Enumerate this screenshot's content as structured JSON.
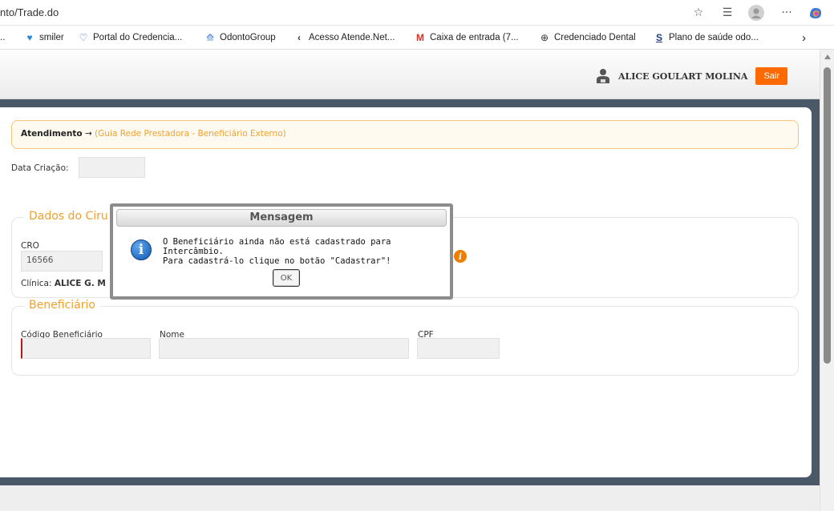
{
  "browser": {
    "address": "nto/Trade.do",
    "bookmarks": [
      {
        "label": "smiler",
        "icon": "tooth-icon"
      },
      {
        "label": "Portal do Credencia...",
        "icon": "heart-icon"
      },
      {
        "label": "OdontoGroup",
        "icon": "odontogroup-icon"
      },
      {
        "label": "Acesso Atende.Net...",
        "icon": "chevron-left-icon"
      },
      {
        "label": "Caixa de entrada (7...",
        "icon": "gmail-icon"
      },
      {
        "label": "Credenciado Dental",
        "icon": "globe-icon"
      },
      {
        "label": "Plano de saúde odo...",
        "icon": "s-logo-icon"
      }
    ]
  },
  "header": {
    "user_name": "ALICE GOULART MOLINA",
    "logout_label": "Sair"
  },
  "breadcrumb": {
    "main": "Atendimento",
    "arrow": "→",
    "sub": "(Guia Rede Prestadora - Beneficiário Externo)"
  },
  "form": {
    "creation_date_label": "Data Criação:",
    "creation_date_value": "",
    "surgeon_section": {
      "legend": "Dados do Ciru",
      "cro_label": "CRO",
      "cro_value": "16566",
      "clinic_label": "Clínica:",
      "clinic_value": "ALICE G. M"
    },
    "beneficiary_section": {
      "legend": "Beneficiário",
      "code_label": "Código Beneficiário",
      "name_label": "Nome",
      "cpf_label": "CPF"
    }
  },
  "dialog": {
    "title": "Mensagem",
    "line1": "O Beneficiário ainda não está cadastrado para Intercâmbio.",
    "line2": "Para cadastrá-lo clique no botão \"Cadastrar\"!",
    "ok_label": "OK"
  },
  "colors": {
    "accent_orange": "#f0a030",
    "logout_orange": "#ff6a00",
    "dark_band": "#4b5867"
  }
}
